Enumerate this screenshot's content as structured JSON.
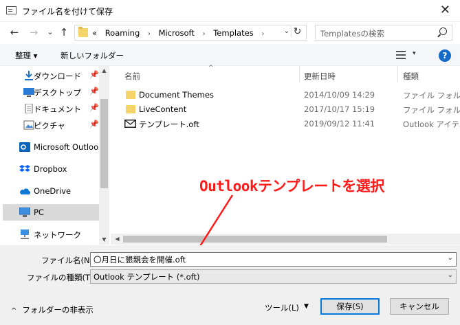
{
  "window": {
    "title": "ファイル名を付けて保存",
    "close": "✕"
  },
  "nav": {
    "back": "←",
    "forward": "→",
    "dropdown": "⌄",
    "up": "↑"
  },
  "address": {
    "overflow": "«",
    "crumbs": [
      "Roaming",
      "Microsoft",
      "Templates"
    ],
    "separator": "›",
    "dropdown": "⌄",
    "refresh": "↻"
  },
  "search": {
    "placeholder": "Templatesの検索"
  },
  "toolbar": {
    "organize": "整理 ▾",
    "new_folder": "新しいフォルダー",
    "view_dropdown": "▾",
    "help": "?"
  },
  "sidebar": {
    "items": [
      {
        "label": "ダウンロード",
        "icon": "download-icon",
        "pinned": true
      },
      {
        "label": "デスクトップ",
        "icon": "desktop-icon",
        "pinned": true
      },
      {
        "label": "ドキュメント",
        "icon": "document-icon",
        "pinned": true
      },
      {
        "label": "ピクチャ",
        "icon": "picture-icon",
        "pinned": true
      },
      {
        "label": "Microsoft Outlook",
        "icon": "outlook-icon",
        "pinned": false
      },
      {
        "label": "Dropbox",
        "icon": "dropbox-icon",
        "pinned": false
      },
      {
        "label": "OneDrive",
        "icon": "onedrive-icon",
        "pinned": false
      },
      {
        "label": "PC",
        "icon": "pc-icon",
        "pinned": false,
        "selected": true
      },
      {
        "label": "ネットワーク",
        "icon": "network-icon",
        "pinned": false
      }
    ],
    "pin_glyph": "📌"
  },
  "columns": {
    "name": "名前",
    "date": "更新日時",
    "type": "種類",
    "sort": "^"
  },
  "files": [
    {
      "name": "Document Themes",
      "date": "2014/10/09 14:29",
      "type": "ファイル フォルダー",
      "icon": "folder-icon"
    },
    {
      "name": "LiveContent",
      "date": "2017/10/17 15:19",
      "type": "ファイル フォルダー",
      "icon": "folder-icon"
    },
    {
      "name": "テンプレート.oft",
      "date": "2019/09/12 11:41",
      "type": "Outlook アイテム",
      "icon": "mail-template-icon"
    }
  ],
  "annotation": {
    "text": "Outlookテンプレートを選択",
    "color": "#ff1a1a"
  },
  "form": {
    "filename_label": "ファイル名(N):",
    "filename_value": "〇月日に懇親会を開催.oft",
    "filetype_label": "ファイルの種類(T):",
    "filetype_value": "Outlook テンプレート (*.oft)",
    "caret": "⌄"
  },
  "footer": {
    "hide_folders": "フォルダーの非表示",
    "hide_caret": "^",
    "tools": "ツール(L)",
    "tools_dd": "▼",
    "save": "保存(S)",
    "cancel": "キャンセル"
  },
  "colors": {
    "accent": "#0078d7",
    "selected": "#d9d9d9",
    "folder": "#f5d46b",
    "help": "#1569c7"
  }
}
